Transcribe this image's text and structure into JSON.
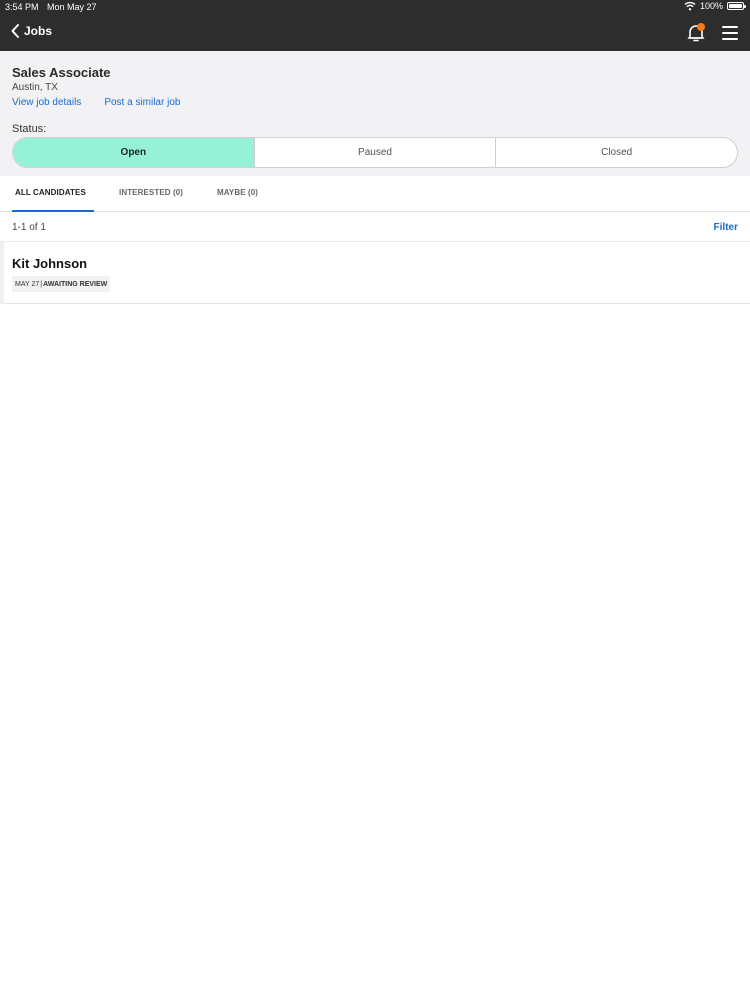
{
  "status_bar": {
    "time": "3:54 PM",
    "date": "Mon May 27",
    "battery": "100%"
  },
  "nav": {
    "back_label": "Jobs",
    "icons": [
      "chevron-left-icon",
      "bell-icon",
      "hamburger-menu-icon"
    ],
    "notification_dot_color": "#f47c20"
  },
  "job": {
    "title": "Sales Associate",
    "location": "Austin, TX",
    "view_details_link": "View job details",
    "post_similar_link": "Post a similar job",
    "status_label": "Status:",
    "status_options": [
      "Open",
      "Paused",
      "Closed"
    ],
    "selected_status": "Open",
    "active_color": "#96f2d7"
  },
  "tabs": [
    {
      "label": "ALL CANDIDATES",
      "active": true
    },
    {
      "label": "INTERESTED (0)",
      "active": false
    },
    {
      "label": "MAYBE (0)",
      "active": false
    }
  ],
  "results": {
    "count_text": "1-1 of 1",
    "filter_label": "Filter"
  },
  "candidates": [
    {
      "name": "Kit Johnson",
      "date": "MAY 27",
      "separator": "|",
      "state": "AWAITING REVIEW"
    }
  ],
  "accent_color": "#1a6bd1"
}
